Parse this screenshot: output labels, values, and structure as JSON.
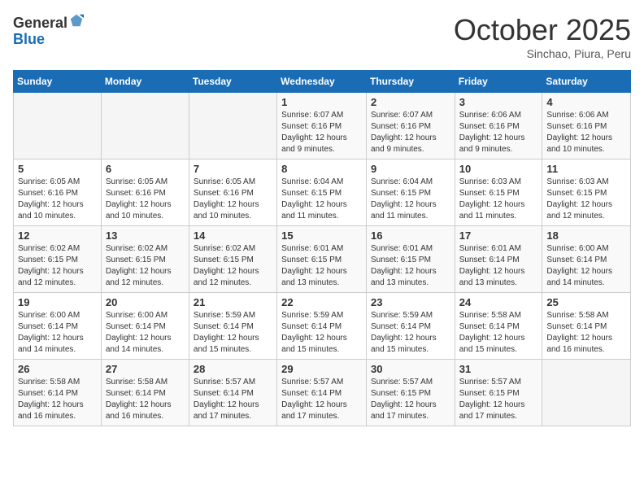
{
  "header": {
    "logo_line1": "General",
    "logo_line2": "Blue",
    "month": "October 2025",
    "location": "Sinchao, Piura, Peru"
  },
  "weekdays": [
    "Sunday",
    "Monday",
    "Tuesday",
    "Wednesday",
    "Thursday",
    "Friday",
    "Saturday"
  ],
  "weeks": [
    [
      {
        "day": "",
        "info": ""
      },
      {
        "day": "",
        "info": ""
      },
      {
        "day": "",
        "info": ""
      },
      {
        "day": "1",
        "info": "Sunrise: 6:07 AM\nSunset: 6:16 PM\nDaylight: 12 hours and 9 minutes."
      },
      {
        "day": "2",
        "info": "Sunrise: 6:07 AM\nSunset: 6:16 PM\nDaylight: 12 hours and 9 minutes."
      },
      {
        "day": "3",
        "info": "Sunrise: 6:06 AM\nSunset: 6:16 PM\nDaylight: 12 hours and 9 minutes."
      },
      {
        "day": "4",
        "info": "Sunrise: 6:06 AM\nSunset: 6:16 PM\nDaylight: 12 hours and 10 minutes."
      }
    ],
    [
      {
        "day": "5",
        "info": "Sunrise: 6:05 AM\nSunset: 6:16 PM\nDaylight: 12 hours and 10 minutes."
      },
      {
        "day": "6",
        "info": "Sunrise: 6:05 AM\nSunset: 6:16 PM\nDaylight: 12 hours and 10 minutes."
      },
      {
        "day": "7",
        "info": "Sunrise: 6:05 AM\nSunset: 6:16 PM\nDaylight: 12 hours and 10 minutes."
      },
      {
        "day": "8",
        "info": "Sunrise: 6:04 AM\nSunset: 6:15 PM\nDaylight: 12 hours and 11 minutes."
      },
      {
        "day": "9",
        "info": "Sunrise: 6:04 AM\nSunset: 6:15 PM\nDaylight: 12 hours and 11 minutes."
      },
      {
        "day": "10",
        "info": "Sunrise: 6:03 AM\nSunset: 6:15 PM\nDaylight: 12 hours and 11 minutes."
      },
      {
        "day": "11",
        "info": "Sunrise: 6:03 AM\nSunset: 6:15 PM\nDaylight: 12 hours and 12 minutes."
      }
    ],
    [
      {
        "day": "12",
        "info": "Sunrise: 6:02 AM\nSunset: 6:15 PM\nDaylight: 12 hours and 12 minutes."
      },
      {
        "day": "13",
        "info": "Sunrise: 6:02 AM\nSunset: 6:15 PM\nDaylight: 12 hours and 12 minutes."
      },
      {
        "day": "14",
        "info": "Sunrise: 6:02 AM\nSunset: 6:15 PM\nDaylight: 12 hours and 12 minutes."
      },
      {
        "day": "15",
        "info": "Sunrise: 6:01 AM\nSunset: 6:15 PM\nDaylight: 12 hours and 13 minutes."
      },
      {
        "day": "16",
        "info": "Sunrise: 6:01 AM\nSunset: 6:15 PM\nDaylight: 12 hours and 13 minutes."
      },
      {
        "day": "17",
        "info": "Sunrise: 6:01 AM\nSunset: 6:14 PM\nDaylight: 12 hours and 13 minutes."
      },
      {
        "day": "18",
        "info": "Sunrise: 6:00 AM\nSunset: 6:14 PM\nDaylight: 12 hours and 14 minutes."
      }
    ],
    [
      {
        "day": "19",
        "info": "Sunrise: 6:00 AM\nSunset: 6:14 PM\nDaylight: 12 hours and 14 minutes."
      },
      {
        "day": "20",
        "info": "Sunrise: 6:00 AM\nSunset: 6:14 PM\nDaylight: 12 hours and 14 minutes."
      },
      {
        "day": "21",
        "info": "Sunrise: 5:59 AM\nSunset: 6:14 PM\nDaylight: 12 hours and 15 minutes."
      },
      {
        "day": "22",
        "info": "Sunrise: 5:59 AM\nSunset: 6:14 PM\nDaylight: 12 hours and 15 minutes."
      },
      {
        "day": "23",
        "info": "Sunrise: 5:59 AM\nSunset: 6:14 PM\nDaylight: 12 hours and 15 minutes."
      },
      {
        "day": "24",
        "info": "Sunrise: 5:58 AM\nSunset: 6:14 PM\nDaylight: 12 hours and 15 minutes."
      },
      {
        "day": "25",
        "info": "Sunrise: 5:58 AM\nSunset: 6:14 PM\nDaylight: 12 hours and 16 minutes."
      }
    ],
    [
      {
        "day": "26",
        "info": "Sunrise: 5:58 AM\nSunset: 6:14 PM\nDaylight: 12 hours and 16 minutes."
      },
      {
        "day": "27",
        "info": "Sunrise: 5:58 AM\nSunset: 6:14 PM\nDaylight: 12 hours and 16 minutes."
      },
      {
        "day": "28",
        "info": "Sunrise: 5:57 AM\nSunset: 6:14 PM\nDaylight: 12 hours and 17 minutes."
      },
      {
        "day": "29",
        "info": "Sunrise: 5:57 AM\nSunset: 6:14 PM\nDaylight: 12 hours and 17 minutes."
      },
      {
        "day": "30",
        "info": "Sunrise: 5:57 AM\nSunset: 6:15 PM\nDaylight: 12 hours and 17 minutes."
      },
      {
        "day": "31",
        "info": "Sunrise: 5:57 AM\nSunset: 6:15 PM\nDaylight: 12 hours and 17 minutes."
      },
      {
        "day": "",
        "info": ""
      }
    ]
  ]
}
